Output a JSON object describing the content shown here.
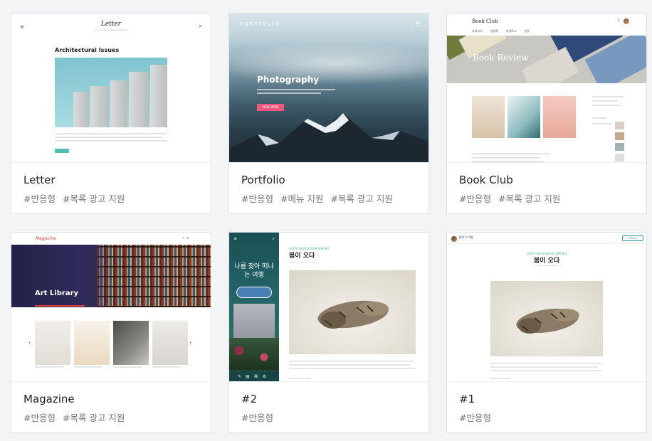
{
  "cards": [
    {
      "name": "Letter",
      "tags": [
        "#반응형",
        "#목록 광고 지원"
      ],
      "preview": {
        "logo": "Letter",
        "logo_sub": "Your amazing tagline text here",
        "heading": "Architectural Issues"
      }
    },
    {
      "name": "Portfolio",
      "tags": [
        "#반응형",
        "#메뉴 지원",
        "#목록 광고 지원"
      ],
      "preview": {
        "logo": "PORTFOLIO",
        "heading": "Photography",
        "button": "VIEW MORE"
      }
    },
    {
      "name": "Book Club",
      "tags": [
        "#반응형",
        "#목록 광고 지원"
      ],
      "preview": {
        "logo": "Book Club",
        "nav": [
          "카테고리",
          "방명록",
          "지역로그",
          "분류"
        ],
        "hero": "Book Review"
      }
    },
    {
      "name": "Magazine",
      "tags": [
        "#반응형",
        "#목록 광고 지원"
      ],
      "preview": {
        "logo": "Magazine",
        "hero": "Art Library"
      }
    },
    {
      "name": "#2",
      "tags": [
        "#반응형"
      ],
      "preview": {
        "side_text_1": "나를 찾아 떠나",
        "side_text_2": "는 여행",
        "category": "고양이 이야기/고양이와 함께 살기",
        "heading": "봄이 오다"
      }
    },
    {
      "name": "#1",
      "tags": [
        "#반응형"
      ],
      "preview": {
        "blog": "블로그 이름",
        "button": "구독하기",
        "category": "고양이 이야기/고양이와 함께 살기",
        "heading": "봄이 오다"
      }
    }
  ]
}
